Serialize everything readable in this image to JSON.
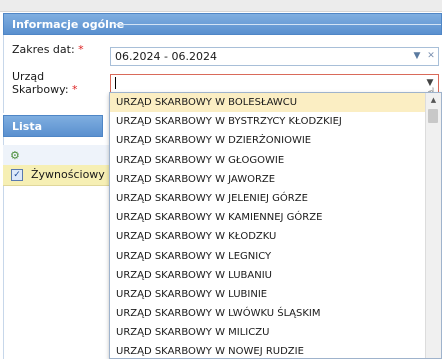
{
  "panel_general": {
    "title": "Informacje ogólne"
  },
  "form": {
    "date_range": {
      "label": "Zakres dat:",
      "required_mark": "*",
      "value": "06.2024 - 06.2024"
    },
    "tax_office": {
      "label_line1": "Urząd",
      "label_line2": "Skarbowy:",
      "required_mark": "*",
      "value": ""
    }
  },
  "panel_warehouses": {
    "title": "Lista magazynów j"
  },
  "warehouse_grid": {
    "rows": [
      {
        "name": "Żywnościowy",
        "checked": true
      }
    ]
  },
  "dropdown": {
    "items": [
      "URZĄD SKARBOWY W BOLESŁAWCU",
      "URZĄD SKARBOWY W BYSTRZYCY KŁODZKIEJ",
      "URZĄD SKARBOWY W DZIERŻONIOWIE",
      "URZĄD SKARBOWY W GŁOGOWIE",
      "URZĄD SKARBOWY W JAWORZE",
      "URZĄD SKARBOWY W JELENIEJ GÓRZE",
      "URZĄD SKARBOWY W KAMIENNEJ GÓRZE",
      "URZĄD SKARBOWY W KŁODZKU",
      "URZĄD SKARBOWY W LEGNICY",
      "URZĄD SKARBOWY W LUBANIU",
      "URZĄD SKARBOWY W LUBINIE",
      "URZĄD SKARBOWY W LWÓWKU ŚLĄSKIM",
      "URZĄD SKARBOWY W MILICZU",
      "URZĄD SKARBOWY W NOWEJ RUDZIE"
    ]
  },
  "icons": {
    "dropdown_arrow": "chevron-down-icon",
    "clear": "close-icon",
    "grid_header": "grid-settings-icon",
    "scroll_up": "arrow-up-icon"
  },
  "colors": {
    "header_blue": "#5a90cf",
    "selected_item": "#fbeec3",
    "selected_row": "#f6efb4",
    "required": "#dd2222",
    "invalid_border": "#d96a5a"
  }
}
